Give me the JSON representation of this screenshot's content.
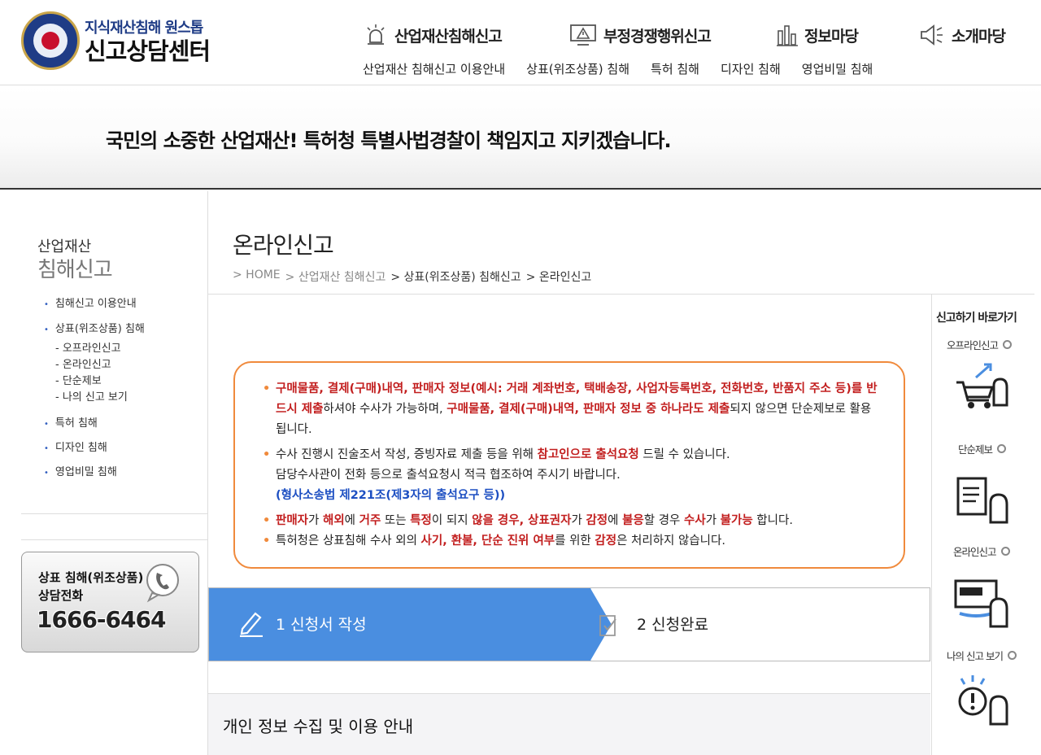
{
  "header": {
    "logo_line1": "지식재산침해 원스톱",
    "logo_line2": "신고상담센터",
    "gnb": [
      {
        "label": "산업재산침해신고",
        "icon": "alarm-light-icon"
      },
      {
        "label": "부정경쟁행위신고",
        "icon": "warning-monitor-icon"
      },
      {
        "label": "정보마당",
        "icon": "bar-chart-icon"
      },
      {
        "label": "소개마당",
        "icon": "megaphone-icon"
      }
    ],
    "subnav": [
      "산업재산 침해신고 이용안내",
      "상표(위조상품) 침해",
      "특허 침해",
      "디자인 침해",
      "영업비밀 침해"
    ]
  },
  "banner": {
    "text": "국민의 소중한 산업재산! 특허청 특별사법경찰이 책임지고 지키겠습니다."
  },
  "sidebar": {
    "title_small": "산업재산",
    "title_large": "침해신고",
    "items": [
      {
        "label": "침해신고 이용안내"
      },
      {
        "label": "상표(위조상품) 침해"
      },
      {
        "label": "특허 침해"
      },
      {
        "label": "디자인 침해"
      },
      {
        "label": "영업비밀 침해"
      }
    ],
    "subitems": [
      "- 오프라인신고",
      "- 온라인신고",
      "- 단순제보",
      "- 나의 신고 보기"
    ],
    "phone": {
      "line1": "상표 침해(위조상품)",
      "line2": "상담전화",
      "number": "1666-6464"
    }
  },
  "main": {
    "title": "온라인신고",
    "breadcrumb": [
      "> HOME",
      "> 산업재산 침해신고",
      "> 상표(위조상품) 침해신고",
      "> 온라인신고"
    ],
    "notice": {
      "b1": {
        "r1": "구매물품, 결제(구매)내역, 판매자 정보(예시: 거래 계좌번호, 택배송장, 사업자등록번호, 전화번호, 반품지 주소 등)를 반드시 제출",
        "t1": "하셔야 수사가 가능하며, ",
        "r2": "구매물품, 결제(구매)내역, 판매자 정보 중 하나라도 제출",
        "t2": "되지 않으면 단순제보로 활용됩니다."
      },
      "b2": {
        "t1": "수사 진행시 진술조서 작성, 증빙자료 제출 등을 위해 ",
        "r1": "참고인으로 출석요청",
        "t2": " 드릴 수 있습니다.",
        "line2": "담당수사관이 전화 등으로 출석요청시 적극 협조하여 주시기 바랍니다.",
        "law": "(형사소송법 제221조(제3자의 출석요구 등))"
      },
      "b3": {
        "r1": "판매자",
        "t1": "가 ",
        "r2": "해외",
        "t2": "에 ",
        "r3": "거주",
        "t3": " 또는 ",
        "r4": "특정",
        "t4": "이 되지 ",
        "r5": "않을 경우, 상표권자",
        "t5": "가 ",
        "r6": "감정",
        "t6": "에 ",
        "r7": "불응",
        "t7": "할 경우 ",
        "r8": "수사",
        "t8": "가 ",
        "r9": "불가능",
        "t9": " 합니다."
      },
      "b4": {
        "t1": "특허청은 상표침해 수사 외의 ",
        "r1": "사기, 환불, 단순 진위 여부",
        "t2": "를 위한 ",
        "r2": "감정",
        "t3": "은 처리하지 않습니다."
      }
    },
    "steps": [
      {
        "label": "1 신청서 작성",
        "active": true
      },
      {
        "label": "2 신청완료",
        "active": false
      }
    ],
    "privacy_title": "개인 정보 수집 및 이용 안내"
  },
  "quick_menu": {
    "title": "신고하기 바로가기",
    "items": [
      {
        "label": "오프라인신고",
        "icon": "cart-report-icon"
      },
      {
        "label": "단순제보",
        "icon": "clipboard-report-icon"
      },
      {
        "label": "온라인신고",
        "icon": "shopping-monitor-icon"
      },
      {
        "label": "나의 신고 보기",
        "icon": "question-person-icon"
      }
    ]
  },
  "colors": {
    "primary_blue": "#4a8ee0",
    "notice_orange": "#f08a3c",
    "emphasis_red": "#c21e1e",
    "law_blue": "#1d4fc2",
    "logo_navy": "#1f3c86"
  }
}
